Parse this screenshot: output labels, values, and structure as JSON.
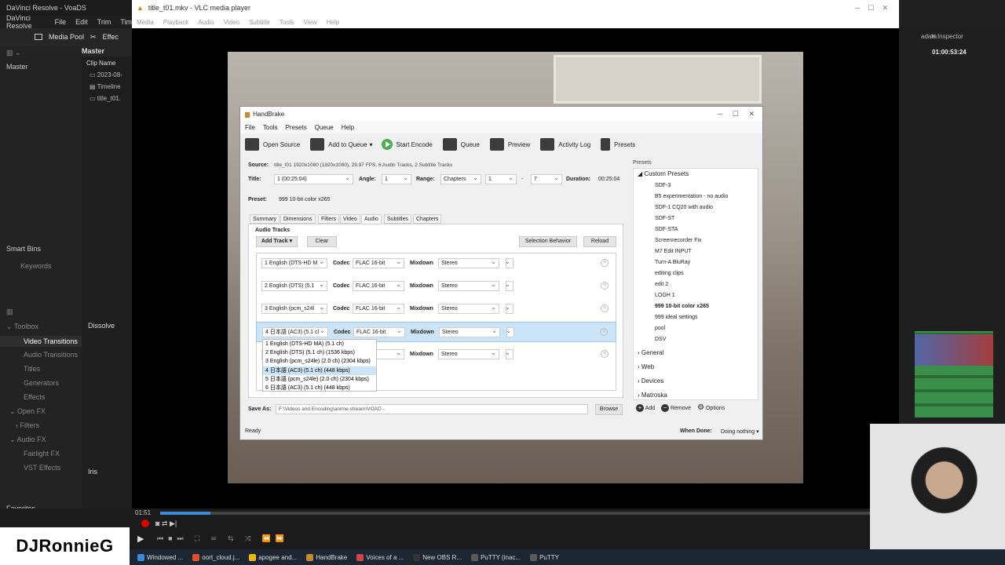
{
  "resolve": {
    "title": "DaVinci Resolve - VoaDS",
    "menu": [
      "DaVinci Resolve",
      "File",
      "Edit",
      "Trim",
      "Tim"
    ],
    "toolbar": {
      "media_pool": "Media Pool",
      "effects": "Effec"
    },
    "master": "Master",
    "master_bin": "Master",
    "clip_name_header": "Clip Name",
    "clips": [
      "2023-08-",
      "Timeline",
      "title_t01."
    ],
    "smart_bins": "Smart Bins",
    "keywords": "Keywords",
    "toolbox": "Toolbox",
    "dissolve": "Dissolve",
    "effects_tree": [
      "Video Transitions",
      "Audio Transitions",
      "Titles",
      "Generators",
      "Effects",
      "Open FX",
      "Filters",
      "Audio FX",
      "Fairlight FX",
      "VST Effects"
    ],
    "iris": "Iris",
    "favorites": "Favorites",
    "right": {
      "metadata": "adata",
      "inspector": "Inspector",
      "timecode": "01:00:53:24"
    }
  },
  "vlc": {
    "title": "title_t01.mkv - VLC media player",
    "menu": [
      "Media",
      "Playback",
      "Audio",
      "Video",
      "Subtitle",
      "Tools",
      "View",
      "Help"
    ],
    "time": "01:51",
    "progress": 0.07
  },
  "handbrake": {
    "title": "HandBrake",
    "menu": [
      "File",
      "Tools",
      "Presets",
      "Queue",
      "Help"
    ],
    "toolbar": {
      "open_source": "Open Source",
      "add_to_queue": "Add to Queue",
      "start_encode": "Start Encode",
      "queue": "Queue",
      "preview": "Preview",
      "activity_log": "Activity Log",
      "presets": "Presets"
    },
    "source_label": "Source:",
    "source_value": "title_t01  1920x1080 (1920x1080), 29.97 FPS, 6 Audio Tracks, 2 Subtitle Tracks",
    "title_label": "Title:",
    "title_value": "1 (00:25:04)",
    "angle_label": "Angle:",
    "angle_value": "1",
    "range_label": "Range:",
    "range_value": "Chapters",
    "range_start": "1",
    "range_sep": "-",
    "range_end": "7",
    "duration_label": "Duration:",
    "duration_value": "00:25:04",
    "preset_label": "Preset:",
    "preset_value": "999 10-bit color x265",
    "tabs": [
      "Summary",
      "Dimensions",
      "Filters",
      "Video",
      "Audio",
      "Subtitles",
      "Chapters"
    ],
    "audio_tracks_heading": "Audio Tracks",
    "add_track": "Add Track",
    "clear": "Clear",
    "selection_behavior": "Selection Behavior",
    "reload": "Reload",
    "codec_label": "Codec",
    "mixdown_label": "Mixdown",
    "tracks": [
      {
        "source": "1 English (DTS-HD M",
        "codec": "FLAC 16-bit",
        "mixdown": "Stereo"
      },
      {
        "source": "2 English (DTS) (5.1",
        "codec": "FLAC 16-bit",
        "mixdown": "Stereo"
      },
      {
        "source": "3 English (pcm_s24l",
        "codec": "FLAC 16-bit",
        "mixdown": "Stereo"
      },
      {
        "source": "4 日本語 (AC3) (5.1 cl",
        "codec": "FLAC 16-bit",
        "mixdown": "Stereo"
      },
      {
        "source": "",
        "codec": "bit",
        "mixdown": "Stereo"
      }
    ],
    "dropdown_options": [
      "1 English (DTS-HD MA) (5.1 ch)",
      "2 English (DTS) (5.1 ch) (1536 kbps)",
      "3 English (pcm_s24le) (2.0 ch) (2304 kbps)",
      "4 日本語 (AC3) (5.1 ch) (448 kbps)",
      "5 日本語 (pcm_s24le) (2.0 ch) (2304 kbps)",
      "6 日本語 (AC3) (5.1 ch) (448 kbps)"
    ],
    "dropdown_selected_index": 3,
    "save_as_label": "Save As:",
    "save_as_value": "F:\\Videos and Encoding\\anime-stream\\VOAD -",
    "browse": "Browse",
    "status": "Ready",
    "when_done_label": "When Done:",
    "when_done_value": "Doing nothing",
    "presets_panel": {
      "heading": "Presets",
      "custom_group": "Custom Presets",
      "custom_items": [
        "SDF-3",
        "B5 experimentation - no audio",
        "SDF-1 CQ20 with audio",
        "SDF-ST",
        "SDF-STA",
        "Screenrecorder Fix",
        "M7 Edit INPUT",
        "Turn-A BluRay",
        "editing clips",
        "edit 2",
        "LOGH 1",
        "999 10-bit color x265",
        "999 ideal settings",
        "pool",
        "DSV"
      ],
      "selected": "999 10-bit color x265",
      "groups": [
        "General",
        "Web",
        "Devices",
        "Matroska"
      ],
      "add": "Add",
      "remove": "Remove",
      "options": "Options"
    }
  },
  "taskbar": [
    "Windowed ...",
    "oort_cloud.j...",
    "apogee and...",
    "HandBrake",
    "Voices of a ...",
    "New OBS R...",
    "PuTTY (inac...",
    "PuTTY"
  ],
  "brand": "DJRonnieG"
}
